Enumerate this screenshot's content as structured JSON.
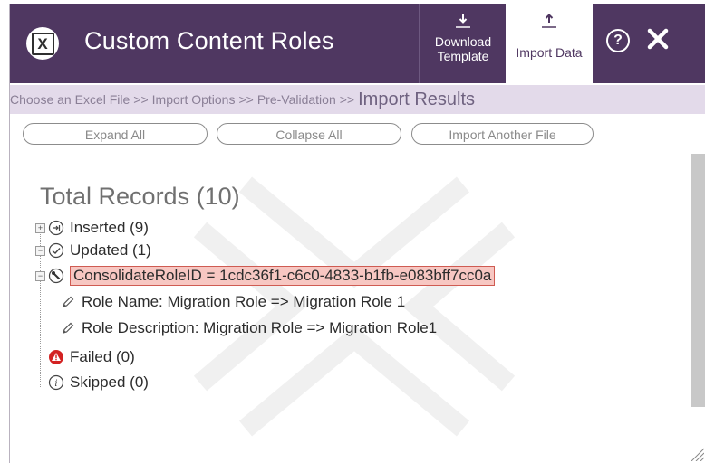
{
  "header": {
    "title": "Custom Content Roles",
    "logo_letter": "X",
    "download_template": {
      "line1": "Download",
      "line2": "Template"
    },
    "import_data": "Import Data",
    "help_glyph": "?"
  },
  "breadcrumb": {
    "steps": [
      "Choose an Excel File",
      "Import Options",
      "Pre-Validation"
    ],
    "separator": ">>",
    "current": "Import Results"
  },
  "actions": {
    "expand_all": "Expand All",
    "collapse_all": "Collapse All",
    "import_another": "Import Another File"
  },
  "results": {
    "total": "Total Records (10)",
    "inserted": "Inserted (9)",
    "updated": "Updated (1)",
    "record_id": "ConsolidateRoleID = 1cdc36f1-c6c0-4833-b1fb-e083bff7cc0a",
    "role_name_change": "Role Name: Migration Role => Migration Role 1",
    "role_description_change": "Role Description: Migration Role => Migration Role1",
    "failed": "Failed (0)",
    "skipped": "Skipped (0)"
  },
  "colors": {
    "header_bg": "#4f3761",
    "breadcrumb_bg": "#e3daea",
    "highlight_bg": "#f7c7c2",
    "highlight_border": "#cf5b52",
    "failed_icon": "#d32222"
  },
  "icons": {
    "inserted": "insert-circle-icon",
    "updated": "check-circle-icon",
    "record": "wrench-circle-icon",
    "field_change": "pencil-icon",
    "failed": "warning-triangle-icon",
    "skipped": "info-circle-icon"
  }
}
